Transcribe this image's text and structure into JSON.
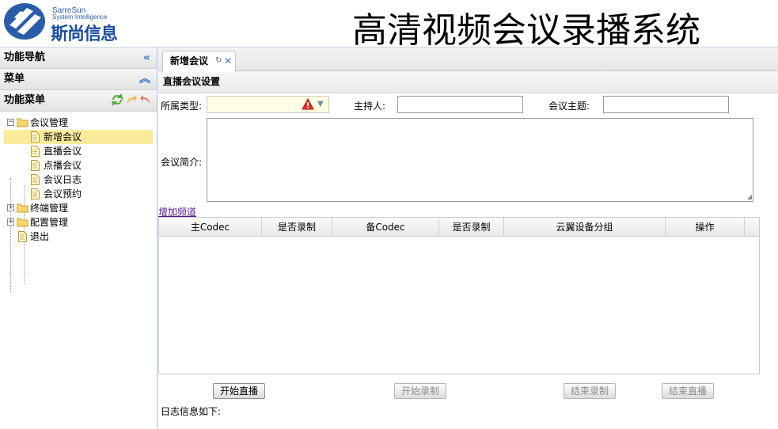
{
  "brand": {
    "name_en_line1": "SarreSun",
    "name_en_line2": "System Intelligence",
    "name_cn": "斯尚信息"
  },
  "app_title": "高清视频会议录播系统",
  "sidebar": {
    "nav_title": "功能导航",
    "menu_title": "菜单",
    "func_menu_title": "功能菜单",
    "tree": [
      {
        "label": "会议管理",
        "expanded": true,
        "children": [
          {
            "label": "新增会议",
            "selected": true
          },
          {
            "label": "直播会议"
          },
          {
            "label": "点播会议"
          },
          {
            "label": "会议日志"
          },
          {
            "label": "会议预约"
          }
        ]
      },
      {
        "label": "终端管理",
        "expanded": false
      },
      {
        "label": "配置管理",
        "expanded": false
      },
      {
        "label": "退出"
      }
    ]
  },
  "tabs": [
    {
      "label": "新增会议",
      "active": true
    }
  ],
  "form": {
    "section_title": "直播会议设置",
    "type_label": "所属类型:",
    "host_label": "主持人:",
    "host_value": "",
    "topic_label": "会议主题:",
    "topic_value": "",
    "intro_label": "会议简介:",
    "intro_value": "",
    "add_channel_link": "增加频道"
  },
  "grid": {
    "columns": [
      "主Codec",
      "是否录制",
      "备Codec",
      "是否录制",
      "云翼设备分组",
      "操作"
    ],
    "rows": []
  },
  "buttons": {
    "start_live": "开始直播",
    "start_record": "开始录制",
    "stop_record": "结束录制",
    "stop_live": "结束直播"
  },
  "log_label": "日志信息如下:",
  "colors": {
    "accent": "#3a78c9",
    "selected_row": "#fbeb9b",
    "required_field": "#fffde3",
    "link": "#551a8b"
  }
}
